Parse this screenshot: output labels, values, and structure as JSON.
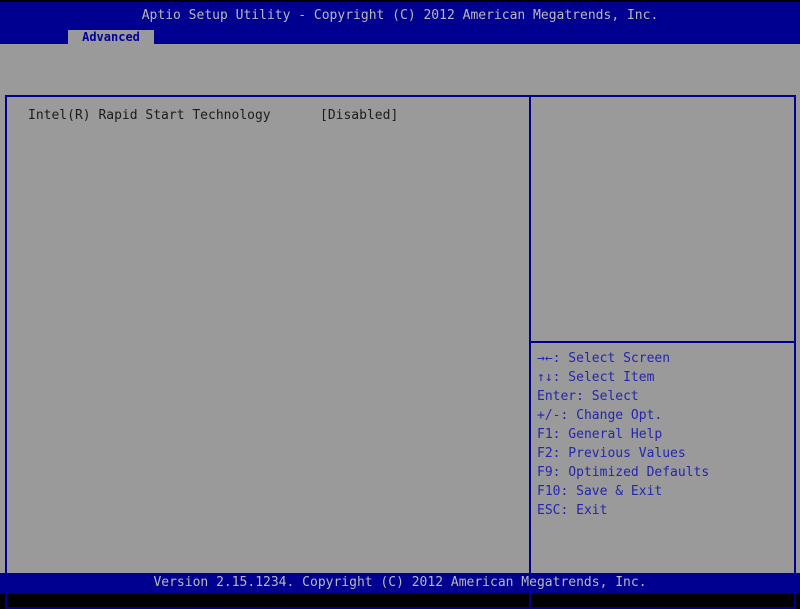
{
  "window": {
    "title_bar": "Aptio Setup Utility - Copyright (C) 2012 American Megatrends, Inc."
  },
  "tabs": [
    {
      "label": "Advanced",
      "active": true
    }
  ],
  "settings": {
    "items": [
      {
        "label": "Intel(R) Rapid Start Technology",
        "value": "[Disabled]"
      }
    ]
  },
  "help_panel": {
    "description": "",
    "keys": [
      "→←: Select Screen",
      "↑↓: Select Item",
      "Enter: Select",
      "+/-: Change Opt.",
      "F1: General Help",
      "F2: Previous Values",
      "F9: Optimized Defaults",
      "F10: Save & Exit",
      "ESC: Exit"
    ]
  },
  "footer": {
    "version_text": "Version 2.15.1234. Copyright (C) 2012 American Megatrends, Inc."
  },
  "colors": {
    "navy": "#000090",
    "body_grey": "#9a9a9a",
    "bar_text_grey": "#b9b9b9",
    "help_text_blue": "#2525b0",
    "item_text": "#1c1c1c",
    "edge_black": "#000000"
  }
}
